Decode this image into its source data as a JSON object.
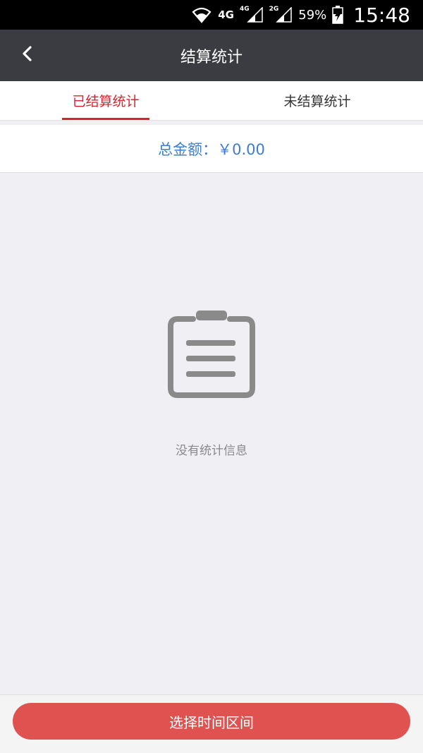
{
  "status_bar": {
    "network_main": "4G",
    "network_sim1": "4G",
    "network_sim2": "2G",
    "battery": "59%",
    "time": "15:48",
    "icons": [
      "wifi-icon",
      "signal-icon",
      "signal-icon",
      "battery-charging-icon"
    ]
  },
  "header": {
    "title": "结算统计",
    "back_icon": "chevron-left-icon"
  },
  "tabs": [
    {
      "label": "已结算统计",
      "active": true
    },
    {
      "label": "未结算统计",
      "active": false
    }
  ],
  "summary": {
    "total_text": "总金额：￥0.00"
  },
  "empty_state": {
    "icon": "clipboard-icon",
    "message": "没有统计信息"
  },
  "footer": {
    "button_label": "选择时间区间"
  },
  "colors": {
    "accent_red": "#d9222e",
    "button_red": "#df524f",
    "header_bg": "#3b3c41",
    "total_blue": "#3d7dd3"
  }
}
